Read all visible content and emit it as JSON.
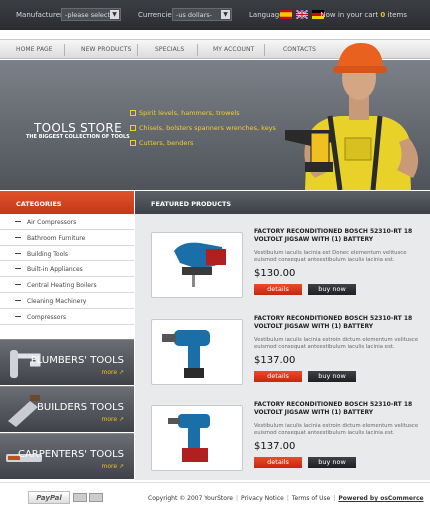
{
  "topbar": {
    "manufacturers_label": "Manufacturers:",
    "manufacturers_value": "-please select-",
    "currencies_label": "Currencies:",
    "currencies_value": "-us dollars-",
    "language_label": "Language:",
    "cart_text": "Now in your cart",
    "cart_count": "0",
    "cart_items": "items"
  },
  "nav": [
    "HOME PAGE",
    "NEW PRODUCTS",
    "SPECIALS",
    "MY ACCOUNT",
    "CONTACTS"
  ],
  "hero": {
    "title": "TOOLS STORE",
    "subtitle": "THE BIGGEST COLLECTION OF TOOLS",
    "bullets": [
      "Spirit levels, hammers, trowels",
      "Chisels, bolsters spanners wrenches, keys",
      "Cutters, benders"
    ]
  },
  "sidebar": {
    "heading": "CATEGORIES",
    "categories": [
      "Air Compressors",
      "Bathroom Furniture",
      "Building Tools",
      "Built-in Appliances",
      "Central Heating Boilers",
      "Cleaning Machinery",
      "Compressors"
    ],
    "promos": [
      {
        "title": "PLUMBERS' TOOLS",
        "more": "more"
      },
      {
        "title": "BUILDERS TOOLS",
        "more": "more"
      },
      {
        "title": "CARPENTERS' TOOLS",
        "more": "more"
      }
    ]
  },
  "featured": {
    "heading": "FEATURED PRODUCTS",
    "products": [
      {
        "title": "FACTORY RECONDITIONED BOSCH 52310-RT 18 VOLTOLT JIGSAW WITH (1) BATTERY",
        "desc": "Vestibulum iaculis lacinia est Donec elementum velitusce euismod consequat anteestibulum iaculis lacinia est.",
        "price": "$130.00",
        "details": "details",
        "buy": "buy now"
      },
      {
        "title": "FACTORY RECONDITIONED BOSCH 52310-RT 18 VOLTOLT JIGSAW WITH (1) BATTERY",
        "desc": "Vestibulum iaculis lacinia estroin dictum elementum velitusce euismod consequat anteestibulum iaculis lacinia est.",
        "price": "$137.00",
        "details": "details",
        "buy": "buy now"
      },
      {
        "title": "FACTORY RECONDITIONED BOSCH 52310-RT 18 VOLTOLT JIGSAW WITH (1) BATTERY",
        "desc": "Vestibulum iaculis lacinia estroin dictum elementum velitusce euismod consequat anteestibulum iaculis lacinia est.",
        "price": "$137.00",
        "details": "details",
        "buy": "buy now"
      }
    ]
  },
  "footer": {
    "paypal": "PayPal",
    "copyright": "Copyright © 2007 YourStore",
    "privacy": "Privacy Notice",
    "terms": "Terms of Use",
    "powered": "Powered by osCommerce"
  },
  "colors": {
    "accent": "#d9431f",
    "highlight": "#f0c020",
    "dark": "#2b2d31"
  }
}
